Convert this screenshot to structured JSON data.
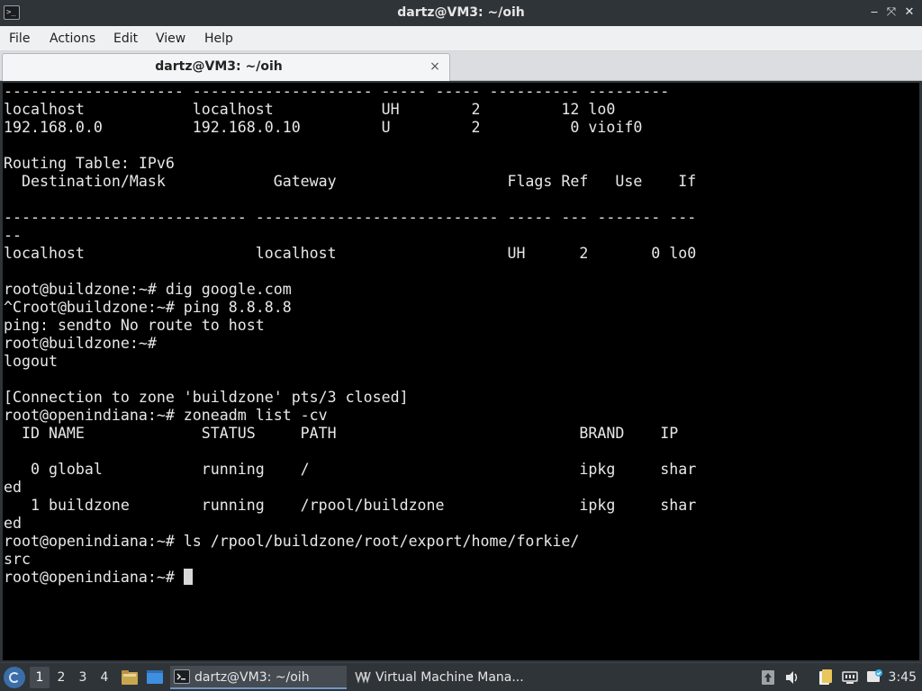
{
  "window": {
    "title": "dartz@VM3: ~/oih"
  },
  "menu": {
    "file": "File",
    "actions": "Actions",
    "edit": "Edit",
    "view": "View",
    "help": "Help"
  },
  "tab": {
    "label": "dartz@VM3: ~/oih",
    "close": "×"
  },
  "terminal": {
    "lines": [
      "-------------------- -------------------- ----- ----- ---------- ---------",
      "localhost            localhost            UH        2         12 lo0",
      "192.168.0.0          192.168.0.10         U         2          0 vioif0",
      "",
      "Routing Table: IPv6",
      "  Destination/Mask            Gateway                   Flags Ref   Use    If",
      "",
      "--------------------------- --------------------------- ----- --- ------- ---",
      "--",
      "localhost                   localhost                   UH      2       0 lo0",
      "",
      "root@buildzone:~# dig google.com",
      "^Croot@buildzone:~# ping 8.8.8.8",
      "ping: sendto No route to host",
      "root@buildzone:~#",
      "logout",
      "",
      "[Connection to zone 'buildzone' pts/3 closed]",
      "root@openindiana:~# zoneadm list -cv",
      "  ID NAME             STATUS     PATH                           BRAND    IP",
      "",
      "   0 global           running    /                              ipkg     shar",
      "ed",
      "   1 buildzone        running    /rpool/buildzone               ipkg     shar",
      "ed",
      "root@openindiana:~# ls /rpool/buildzone/root/export/home/forkie/",
      "src"
    ],
    "prompt": "root@openindiana:~# "
  },
  "taskbar": {
    "workspaces": [
      "1",
      "2",
      "3",
      "4"
    ],
    "tasks": {
      "terminal": "dartz@VM3: ~/oih",
      "vmm": "Virtual Machine Mana..."
    },
    "clock": "3:45"
  },
  "colors": {
    "chrome": "#2f3439",
    "terminal_bg": "#000000",
    "terminal_fg": "#e8e8e8",
    "menubar_bg": "#eff0f1"
  }
}
